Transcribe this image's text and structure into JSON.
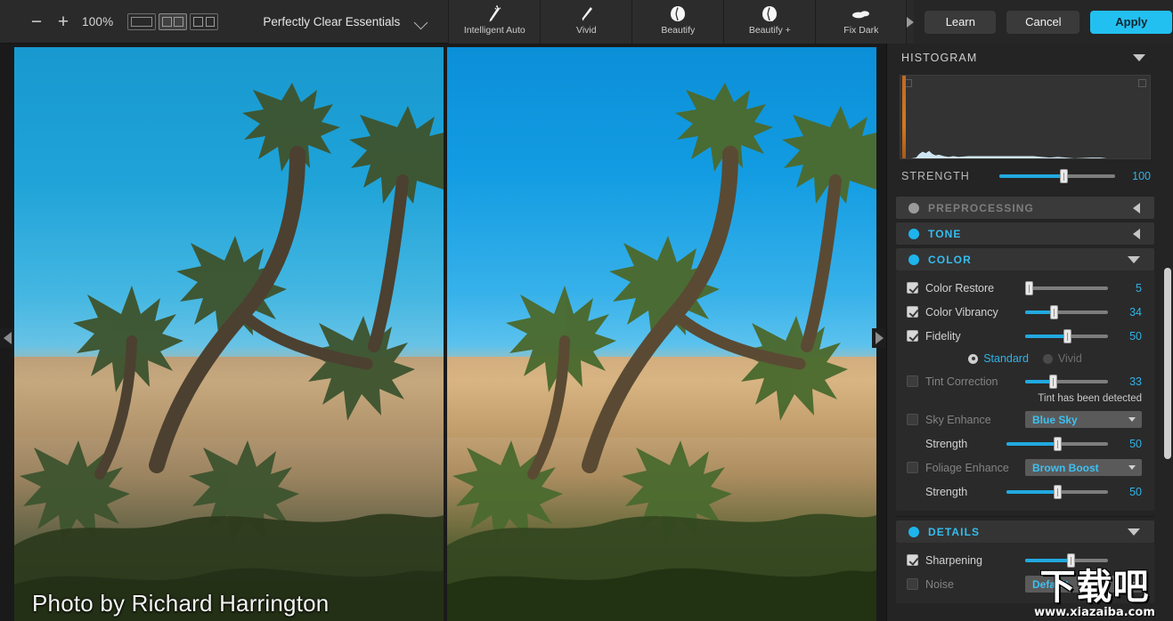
{
  "toolbar": {
    "zoom_out_icon": "minus-icon",
    "zoom_in_icon": "plus-icon",
    "zoom_level": "100%",
    "view_modes": [
      {
        "name": "single-view",
        "selected": false
      },
      {
        "name": "split-view",
        "selected": true
      },
      {
        "name": "side-by-side-view",
        "selected": false
      }
    ],
    "preset_name": "Perfectly Clear Essentials",
    "preset_chevron_icon": "chevron-down-icon",
    "tools": [
      {
        "label": "Intelligent Auto",
        "icon": "magic-wand-icon"
      },
      {
        "label": "Vivid",
        "icon": "brush-icon"
      },
      {
        "label": "Beautify",
        "icon": "face-icon"
      },
      {
        "label": "Beautify +",
        "icon": "face-plus-icon"
      },
      {
        "label": "Fix Dark",
        "icon": "cloud-icon"
      }
    ],
    "scroll_right_icon": "triangle-right-icon",
    "learn_label": "Learn",
    "cancel_label": "Cancel",
    "apply_label": "Apply",
    "accent_color": "#22c0f0"
  },
  "canvas": {
    "left_pane_name": "before-image",
    "right_pane_name": "after-image",
    "credit": "Photo by Richard Harrington",
    "left_edge_arrow_icon": "triangle-left-icon",
    "right_edge_arrow_icon": "triangle-right-icon"
  },
  "panel": {
    "histogram": {
      "title": "HISTOGRAM",
      "collapse_icon": "triangle-down-icon"
    },
    "strength": {
      "label": "STRENGTH",
      "value": "100",
      "fill_percent": 55
    },
    "sections": [
      {
        "title": "PREPROCESSING",
        "enabled": false,
        "expanded": false,
        "arrow": "triangle-left-icon"
      },
      {
        "title": "TONE",
        "enabled": true,
        "expanded": false,
        "arrow": "triangle-left-icon"
      },
      {
        "title": "COLOR",
        "enabled": true,
        "expanded": true,
        "arrow": "triangle-down-icon"
      }
    ],
    "color_controls": {
      "color_restore": {
        "label": "Color Restore",
        "checked": true,
        "value": "5",
        "fill_percent": 4
      },
      "color_vibrancy": {
        "label": "Color Vibrancy",
        "checked": true,
        "value": "34",
        "fill_percent": 34
      },
      "fidelity": {
        "label": "Fidelity",
        "checked": true,
        "value": "50",
        "fill_percent": 50
      },
      "fidelity_modes": [
        {
          "label": "Standard",
          "selected": true
        },
        {
          "label": "Vivid",
          "selected": false
        }
      ],
      "tint_correction": {
        "label": "Tint Correction",
        "checked": false,
        "value": "33",
        "fill_percent": 33
      },
      "tint_note": "Tint has been detected",
      "sky_enhance": {
        "label": "Sky Enhance",
        "checked": false,
        "option": "Blue Sky",
        "dropdown_icon": "caret-down-icon"
      },
      "sky_strength": {
        "label": "Strength",
        "value": "50",
        "fill_percent": 50
      },
      "foliage_enhance": {
        "label": "Foliage Enhance",
        "checked": false,
        "option": "Brown Boost",
        "dropdown_icon": "caret-down-icon"
      },
      "foliage_strength": {
        "label": "Strength",
        "value": "50",
        "fill_percent": 50
      }
    },
    "details_section": {
      "title": "DETAILS",
      "enabled": true,
      "expanded": true,
      "arrow": "triangle-down-icon"
    },
    "details_controls": {
      "sharpening": {
        "label": "Sharpening",
        "checked": true,
        "fill_percent": 55
      },
      "noise": {
        "label": "Noise",
        "checked": false,
        "option": "Default"
      }
    }
  },
  "watermark": {
    "cn_text": "下载吧",
    "url_text": "www.xiazaiba.com"
  }
}
